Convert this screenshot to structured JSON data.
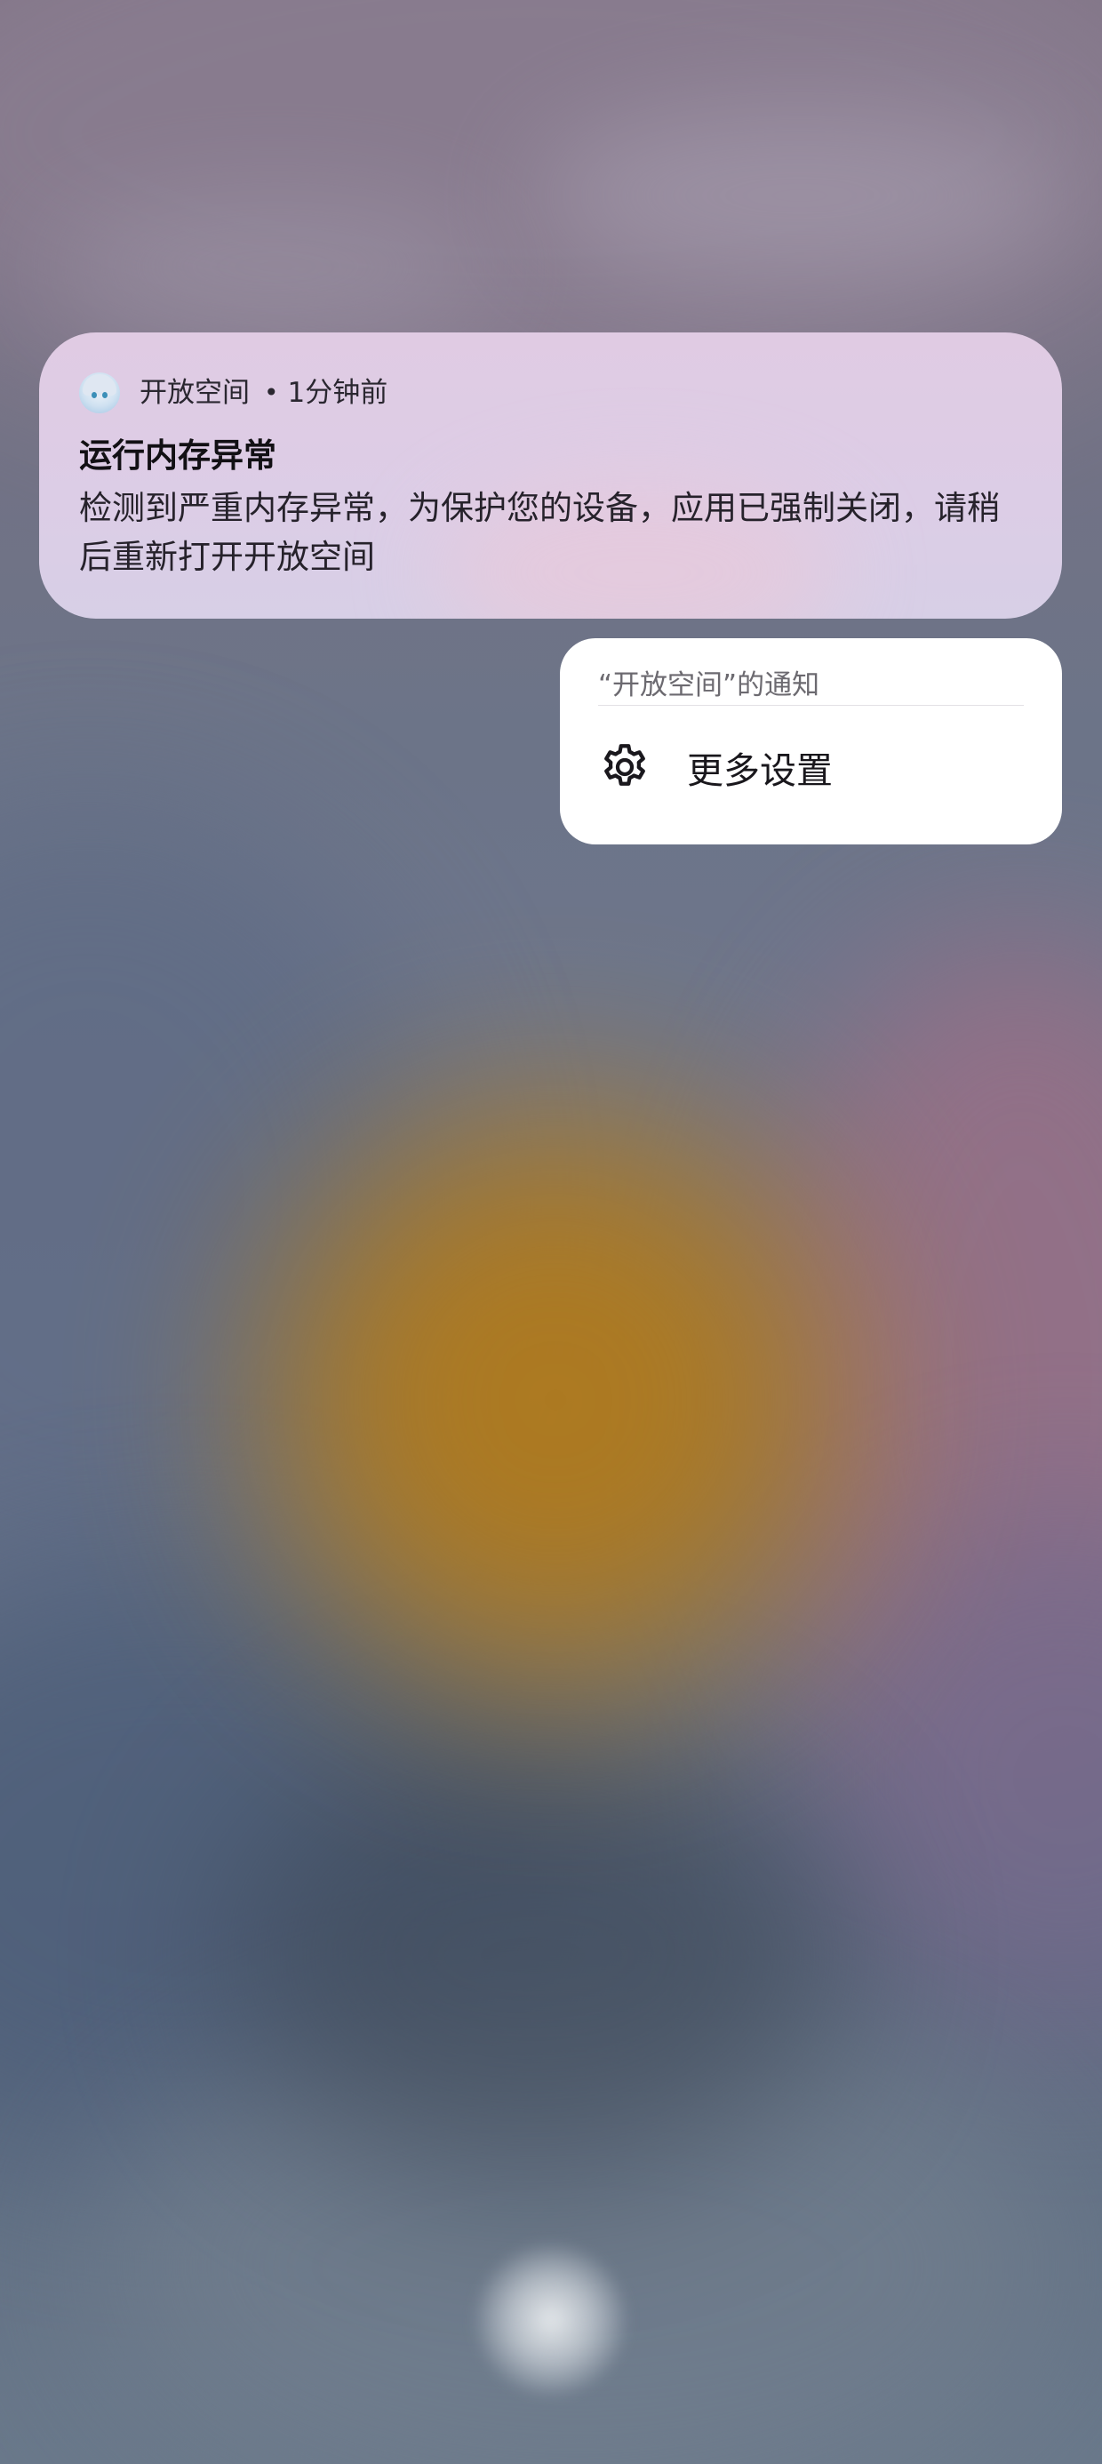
{
  "notification": {
    "app_name": "开放空间",
    "separator": "•",
    "time": "1分钟前",
    "title": "运行内存异常",
    "body": "检测到严重内存异常，为保护您的设备，应用已强制关闭，请稍后重新打开开放空间",
    "app_icon": "anime-avatar-icon"
  },
  "menu": {
    "title": "“开放空间”的通知",
    "items": [
      {
        "label": "更多设置",
        "icon": "gear-icon"
      }
    ]
  }
}
